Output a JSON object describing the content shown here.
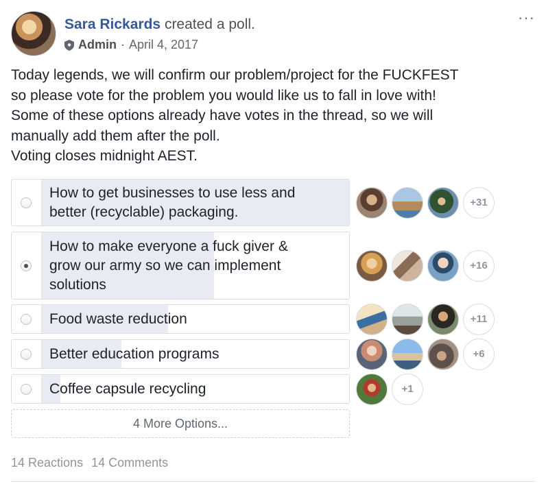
{
  "post": {
    "author": "Sara Rickards",
    "action": "created a poll.",
    "role": "Admin",
    "separator": "·",
    "date": "April 4, 2017",
    "more_icon": "···",
    "body_lines": [
      "Today legends, we will confirm our problem/project for the FUCKFEST",
      "so please vote for the problem you would like us to fall in love with!",
      "Some of these options already have votes in the thread, so we will",
      "manually add them after the poll.",
      "Voting closes midnight AEST."
    ]
  },
  "poll": {
    "options": [
      {
        "lines": [
          "How to get businesses to use less and",
          "better (recyclable) packaging."
        ],
        "selected": false,
        "extra_votes": "+31",
        "vote_fill": 1.0
      },
      {
        "lines": [
          "How to make everyone a fuck giver &",
          "grow our army so we can implement",
          "solutions"
        ],
        "selected": true,
        "extra_votes": "+16",
        "vote_fill": 0.56
      },
      {
        "lines": [
          "Food waste reduction"
        ],
        "selected": false,
        "extra_votes": "+11",
        "vote_fill": 0.41
      },
      {
        "lines": [
          "Better education programs"
        ],
        "selected": false,
        "extra_votes": "+6",
        "vote_fill": 0.26
      },
      {
        "lines": [
          "Coffee capsule recycling"
        ],
        "selected": false,
        "extra_votes": "+1",
        "vote_fill": 0.06
      }
    ],
    "more_options_label": "4 More Options..."
  },
  "footer": {
    "reactions": "14 Reactions",
    "comments": "14 Comments"
  },
  "colors": {
    "author_link": "#385898",
    "poll_fill": "#e9ebf4",
    "muted_text": "#90949c"
  }
}
